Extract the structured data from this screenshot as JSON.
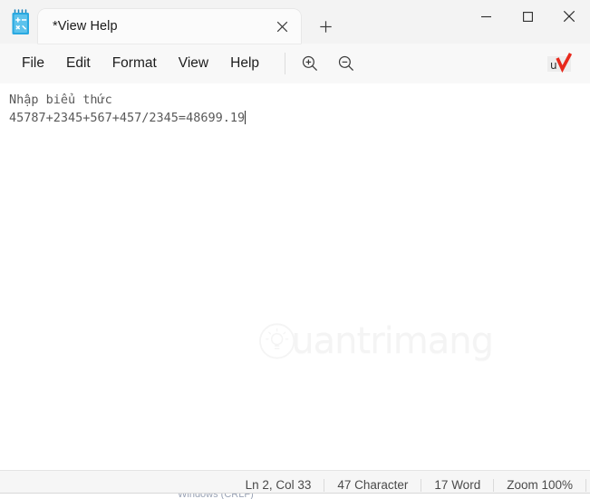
{
  "window": {
    "app_icon_name": "notepad-calculator-icon",
    "tab": {
      "title": "*View Help",
      "close_label": "×",
      "new_tab_label": "+"
    },
    "controls": {
      "minimize_label": "—",
      "maximize_label": "□",
      "close_label": "✕"
    }
  },
  "menubar": {
    "items": [
      {
        "label": "File",
        "name": "menu-file"
      },
      {
        "label": "Edit",
        "name": "menu-edit"
      },
      {
        "label": "Format",
        "name": "menu-format"
      },
      {
        "label": "View",
        "name": "menu-view"
      },
      {
        "label": "Help",
        "name": "menu-help"
      }
    ],
    "zoom_in_name": "zoom-in-icon",
    "zoom_out_name": "zoom-out-icon",
    "ime_label": "u",
    "ime_name": "unikey-vietnamese-indicator"
  },
  "editor": {
    "line1": "Nhập biểu thức",
    "line2": "45787+2345+567+457/2345=48699.19",
    "watermark_text": "uantrimang",
    "watermark_logo_name": "lightbulb-circle-logo"
  },
  "statusbar": {
    "cursor_position": "Ln 2, Col 33",
    "character_count": "47 Character",
    "word_count": "17 Word",
    "zoom_level": "Zoom 100%"
  },
  "colors": {
    "titlebar_bg": "#f3f3f3",
    "menubar_bg": "#f8f8f8",
    "editor_bg": "#ffffff",
    "statusbar_bg": "#f6f6f6",
    "icon_blue": "#29a8e0",
    "ime_red": "#e8291c",
    "text_gray": "#595959"
  }
}
